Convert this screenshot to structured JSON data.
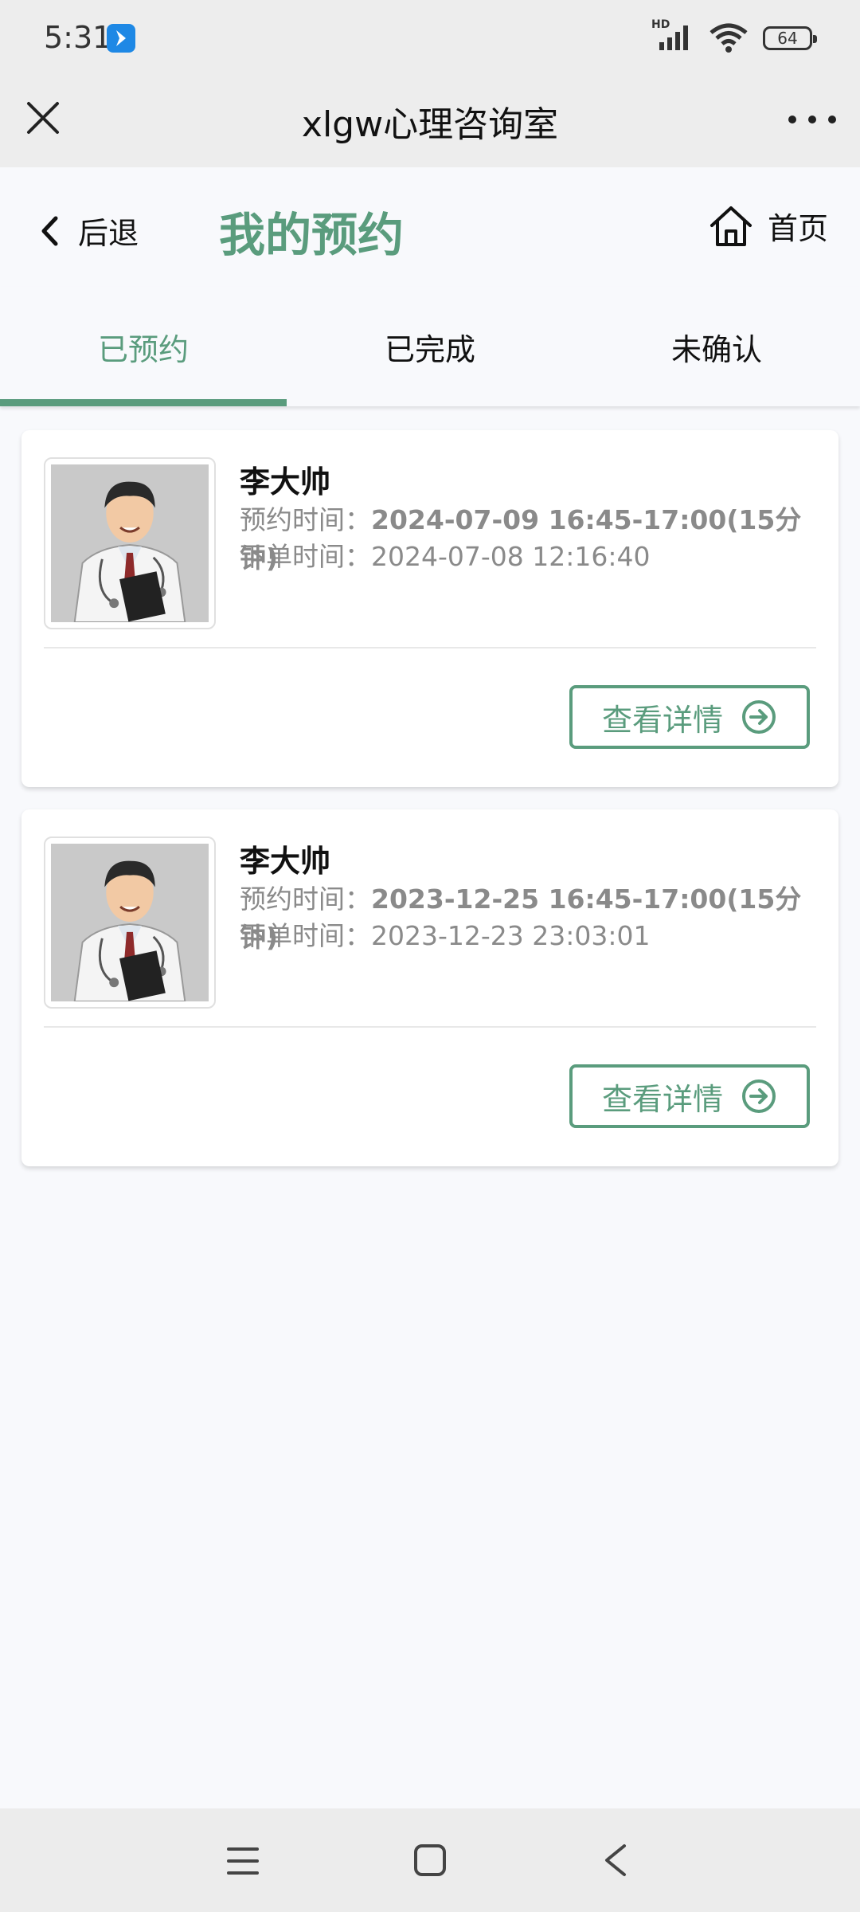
{
  "status_bar": {
    "time": "5:31",
    "network_label": "HD",
    "battery_level": "64"
  },
  "title_bar": {
    "title": "xlgw心理咨询室"
  },
  "page_header": {
    "back_label": "后退",
    "title": "我的预约",
    "home_label": "首页"
  },
  "tabs": [
    {
      "label": "已预约",
      "active": true
    },
    {
      "label": "已完成",
      "active": false
    },
    {
      "label": "未确认",
      "active": false
    }
  ],
  "appointments": [
    {
      "name": "李大帅",
      "appointment_label": "预约时间：",
      "appointment_time": "2024-07-09 16:45-17:00(15分钟)",
      "order_label": "下单时间：",
      "order_time": "2024-07-08 12:16:40",
      "button_label": "查看详情"
    },
    {
      "name": "李大帅",
      "appointment_label": "预约时间：",
      "appointment_time": "2023-12-25 16:45-17:00(15分钟)",
      "order_label": "下单时间：",
      "order_time": "2023-12-23 23:03:01",
      "button_label": "查看详情"
    }
  ],
  "colors": {
    "accent": "#5a9c7d",
    "background": "#f8f9fc",
    "bar": "#ededed"
  }
}
